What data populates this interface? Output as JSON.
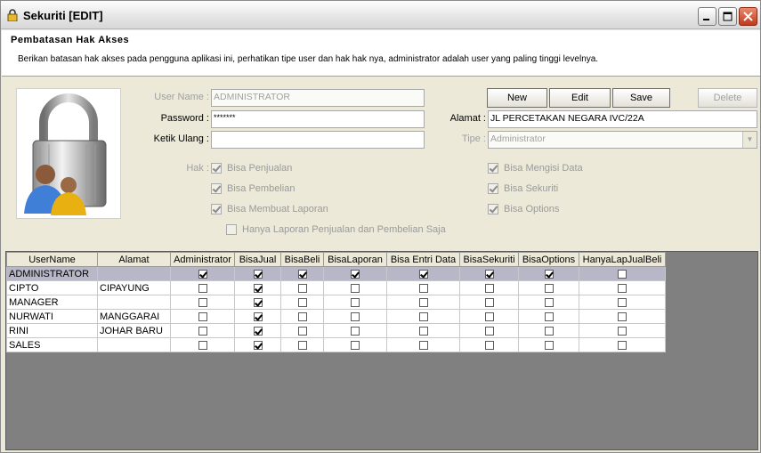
{
  "window": {
    "title": "Sekuriti [EDIT]",
    "controls": [
      "minimize-icon",
      "maximize-icon",
      "close-icon"
    ]
  },
  "header": {
    "title": "Pembatasan Hak Akses",
    "description": "Berikan batasan hak akses pada pengguna aplikasi ini, perhatikan tipe user dan hak hak nya, administrator adalah user yang paling tinggi levelnya."
  },
  "form": {
    "user_name_label": "User Name :",
    "user_name_value": "ADMINISTRATOR",
    "password_label": "Password :",
    "password_value": "*******",
    "retype_label": "Ketik Ulang :",
    "retype_value": "",
    "alamat_label": "Alamat :",
    "alamat_value": "JL PERCETAKAN NEGARA IVC/22A",
    "tipe_label": "Tipe :",
    "tipe_value": "Administrator",
    "hak_label": "Hak :"
  },
  "buttons": {
    "new": "New",
    "edit": "Edit",
    "save": "Save",
    "delete": "Delete"
  },
  "rights": {
    "penjualan": {
      "label": "Bisa Penjualan",
      "checked": true
    },
    "pembelian": {
      "label": "Bisa Pembelian",
      "checked": true
    },
    "laporan": {
      "label": "Bisa Membuat Laporan",
      "checked": true
    },
    "mengisi": {
      "label": "Bisa Mengisi Data",
      "checked": true
    },
    "sekuriti": {
      "label": "Bisa Sekuriti",
      "checked": true
    },
    "options": {
      "label": "Bisa Options",
      "checked": true
    },
    "hanya": {
      "label": "Hanya Laporan Penjualan dan Pembelian Saja",
      "checked": false
    }
  },
  "grid": {
    "columns": [
      "UserName",
      "Alamat",
      "Administrator",
      "BisaJual",
      "BisaBeli",
      "BisaLaporan",
      "Bisa Entri Data",
      "BisaSekuriti",
      "BisaOptions",
      "HanyaLapJualBeli"
    ],
    "rows": [
      {
        "username": "ADMINISTRATOR",
        "alamat": "",
        "flags": [
          true,
          true,
          true,
          true,
          true,
          true,
          true,
          false
        ],
        "selected": true
      },
      {
        "username": "CIPTO",
        "alamat": "CIPAYUNG",
        "flags": [
          false,
          true,
          false,
          false,
          false,
          false,
          false,
          false
        ],
        "selected": false
      },
      {
        "username": "MANAGER",
        "alamat": "",
        "flags": [
          false,
          true,
          false,
          false,
          false,
          false,
          false,
          false
        ],
        "selected": false
      },
      {
        "username": "NURWATI",
        "alamat": "MANGGARAI",
        "flags": [
          false,
          true,
          false,
          false,
          false,
          false,
          false,
          false
        ],
        "selected": false
      },
      {
        "username": "RINI",
        "alamat": "JOHAR BARU",
        "flags": [
          false,
          true,
          false,
          false,
          false,
          false,
          false,
          false
        ],
        "selected": false
      },
      {
        "username": "SALES",
        "alamat": "",
        "flags": [
          false,
          true,
          false,
          false,
          false,
          false,
          false,
          false
        ],
        "selected": false
      }
    ]
  }
}
